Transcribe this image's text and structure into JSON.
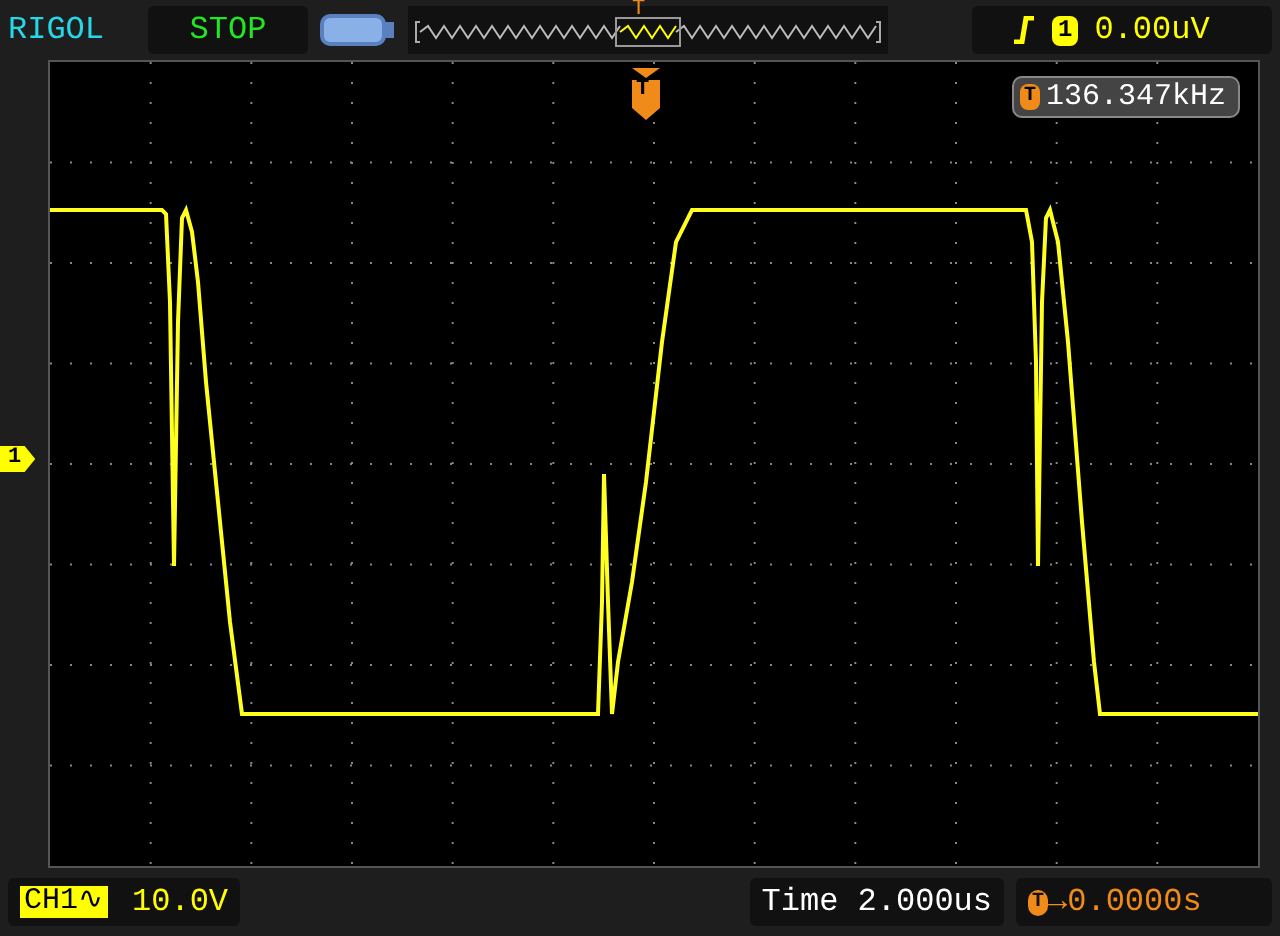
{
  "header": {
    "brand": "RIGOL",
    "run_state": "STOP",
    "overview_marker": "T",
    "trigger": {
      "channel": "1",
      "level": "0.00uV"
    }
  },
  "display": {
    "trigger_marker": "T",
    "frequency": {
      "badge": "T",
      "value": "136.347kHz"
    },
    "channel_marker": "1"
  },
  "footer": {
    "channel": {
      "name": "CH1",
      "coupling_glyph": "∿",
      "scale": "10.0V"
    },
    "timebase": "Time 2.000us",
    "trigger_offset": {
      "badge": "T",
      "value": "→0.0000s"
    }
  }
}
